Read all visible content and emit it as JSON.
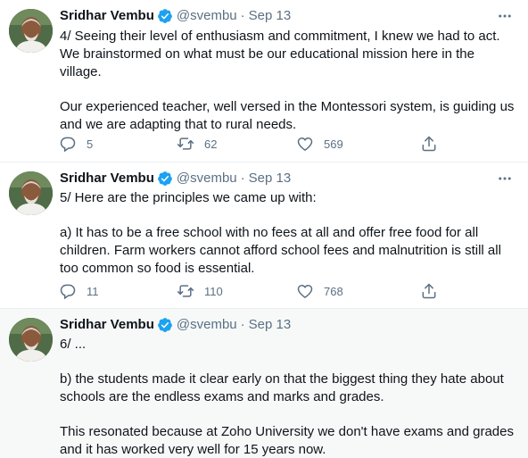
{
  "colors": {
    "accent": "#1da1f2",
    "muted": "#5b7083",
    "text": "#0f1419",
    "divider": "#ebeef0",
    "highlight_bg": "#f7f9f9"
  },
  "icons": {
    "verified": "verified-badge-icon",
    "more": "more-icon",
    "reply": "reply-icon",
    "retweet": "retweet-icon",
    "like": "like-icon",
    "share": "share-icon"
  },
  "tweets": [
    {
      "author": {
        "name": "Sridhar Vembu",
        "handle": "@svembu"
      },
      "separator": "·",
      "date": "Sep 13",
      "paragraphs": [
        "4/ Seeing their level of enthusiasm and commitment, I knew we had to act. We brainstormed on what must be our educational mission here in the village.",
        "Our experienced teacher, well versed in the Montessori system, is guiding us and we are adapting that to rural needs."
      ],
      "stats": {
        "replies": "5",
        "retweets": "62",
        "likes": "569"
      }
    },
    {
      "author": {
        "name": "Sridhar Vembu",
        "handle": "@svembu"
      },
      "separator": "·",
      "date": "Sep 13",
      "paragraphs": [
        "5/ Here are the principles we came up with:",
        "a) It has to be a free school with no fees at all and offer free food for all children. Farm workers cannot afford school fees and malnutrition is still all too common so food is essential."
      ],
      "stats": {
        "replies": "11",
        "retweets": "110",
        "likes": "768"
      }
    },
    {
      "author": {
        "name": "Sridhar Vembu",
        "handle": "@svembu"
      },
      "separator": "·",
      "date": "Sep 13",
      "paragraphs": [
        "6/ ...",
        "b) the students made it clear early on that the biggest thing they hate about schools are  the endless exams and marks and grades.",
        "This resonated because at Zoho University we don't have exams and grades and it has worked very well for 15 years now."
      ]
    }
  ]
}
